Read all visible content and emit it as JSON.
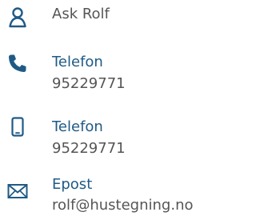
{
  "contact": {
    "name": "Ask Rolf",
    "phone": {
      "label": "Telefon",
      "value": "95229771"
    },
    "mobile": {
      "label": "Telefon",
      "value": "95229771"
    },
    "email": {
      "label": "Epost",
      "value": "rolf@hustegning.no"
    }
  },
  "icons": {
    "person": "person-icon",
    "phone": "phone-icon",
    "mobile": "mobile-phone-icon",
    "email": "envelope-icon"
  },
  "colors": {
    "icon": "#1f5a86",
    "link": "#1f5a86",
    "text": "#555555",
    "background": "#ffffff"
  }
}
